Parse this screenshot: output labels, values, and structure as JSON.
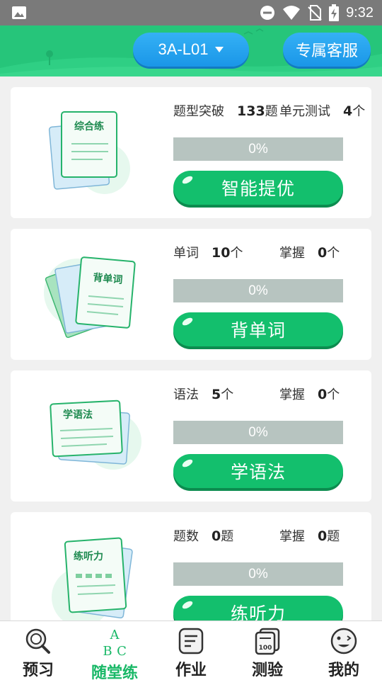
{
  "status_bar": {
    "time": "9:32"
  },
  "header": {
    "unit_selector": "3A-L01",
    "service_button": "专属客服"
  },
  "cards": [
    {
      "illustration_label": "综合练",
      "stat1": {
        "label": "题型突破",
        "value": "133",
        "unit": "题"
      },
      "stat2": {
        "label": "单元测试",
        "value": "4",
        "unit": "个"
      },
      "progress": {
        "percent": 0,
        "text": "0%"
      },
      "button": "智能提优"
    },
    {
      "illustration_label": "背单词",
      "stat1": {
        "label": "单词",
        "value": "10",
        "unit": "个"
      },
      "stat2": {
        "label": "掌握",
        "value": "0",
        "unit": "个"
      },
      "progress": {
        "percent": 0,
        "text": "0%"
      },
      "button": "背单词"
    },
    {
      "illustration_label": "学语法",
      "stat1": {
        "label": "语法",
        "value": "5",
        "unit": "个"
      },
      "stat2": {
        "label": "掌握",
        "value": "0",
        "unit": "个"
      },
      "progress": {
        "percent": 0,
        "text": "0%"
      },
      "button": "学语法"
    },
    {
      "illustration_label": "练听力",
      "stat1": {
        "label": "题数",
        "value": "0",
        "unit": "题"
      },
      "stat2": {
        "label": "掌握",
        "value": "0",
        "unit": "题"
      },
      "progress": {
        "percent": 0,
        "text": "0%"
      },
      "button": "练听力"
    }
  ],
  "bottom_nav": [
    {
      "label": "预习",
      "icon": "magnifier-icon",
      "active": false
    },
    {
      "label": "随堂练",
      "icon": "abc-icon",
      "active": true
    },
    {
      "label": "作业",
      "icon": "document-icon",
      "active": false
    },
    {
      "label": "测验",
      "icon": "test-paper-icon",
      "active": false
    },
    {
      "label": "我的",
      "icon": "smiley-face-icon",
      "active": false
    }
  ],
  "colors": {
    "header_green": "#26c57a",
    "button_blue": "#1a96e8",
    "action_green": "#13bf6d",
    "progress_track": "#b7c4c0",
    "active_nav": "#19b867"
  }
}
